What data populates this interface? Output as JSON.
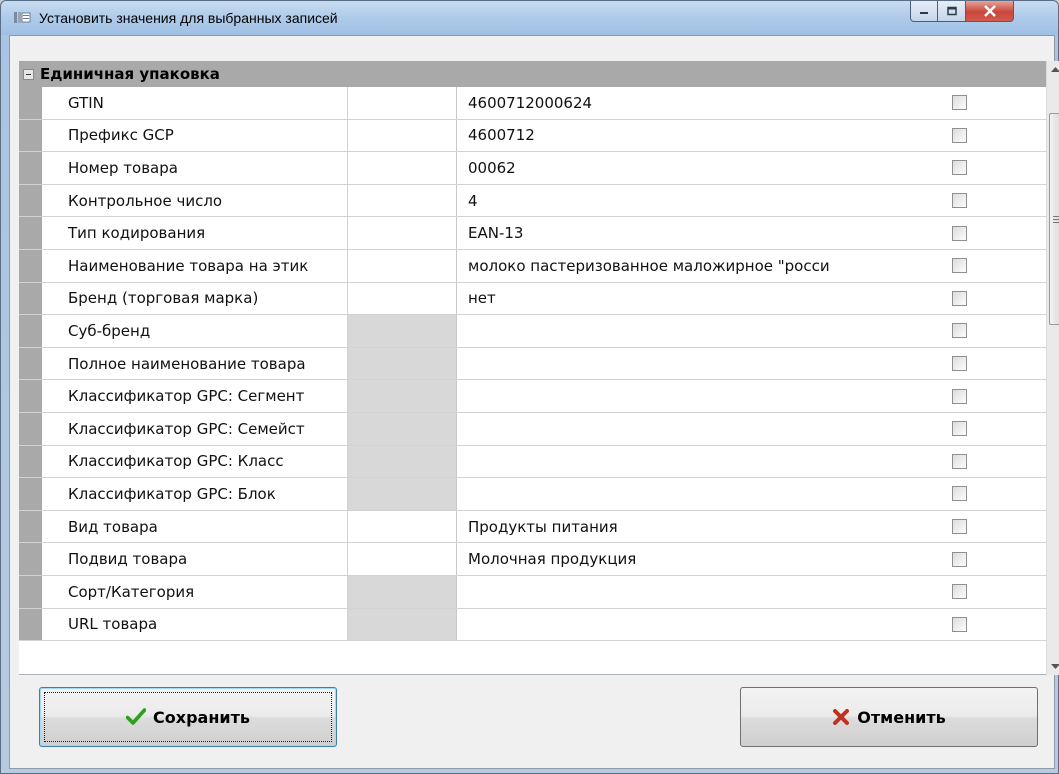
{
  "window": {
    "title": "Установить значения для выбранных записей"
  },
  "group": {
    "title": "Единичная упаковка"
  },
  "rows": [
    {
      "name": "GTIN",
      "value": "4600712000624"
    },
    {
      "name": "Префикс GCP",
      "value": "4600712"
    },
    {
      "name": "Номер товара",
      "value": "00062"
    },
    {
      "name": "Контрольное число",
      "value": "4"
    },
    {
      "name": "Тип кодирования",
      "value": "EAN-13"
    },
    {
      "name": "Наименование товара на этик",
      "value": "молоко пастеризованное маложирное \"росси"
    },
    {
      "name": "Бренд (торговая марка)",
      "value": "нет"
    },
    {
      "name": "Суб-бренд",
      "value": ""
    },
    {
      "name": "Полное наименование товара",
      "value": ""
    },
    {
      "name": "Классификатор GPC: Сегмент",
      "value": ""
    },
    {
      "name": "Классификатор GPC: Семейст",
      "value": ""
    },
    {
      "name": "Классификатор GPC: Класс",
      "value": ""
    },
    {
      "name": "Классификатор GPC: Блок",
      "value": ""
    },
    {
      "name": "Вид товара",
      "value": "Продукты питания"
    },
    {
      "name": "Подвид товара",
      "value": "Молочная продукция"
    },
    {
      "name": "Сорт/Категория",
      "value": ""
    },
    {
      "name": "URL товара",
      "value": ""
    }
  ],
  "buttons": {
    "save_label": "Сохранить",
    "cancel_label": "Отменить"
  },
  "icons": {
    "save": "checkmark-icon",
    "cancel": "x-icon"
  },
  "colors": {
    "save_icon": "#2e9e1f",
    "cancel_icon": "#c0311f",
    "group_header": "#a9a9a9"
  }
}
